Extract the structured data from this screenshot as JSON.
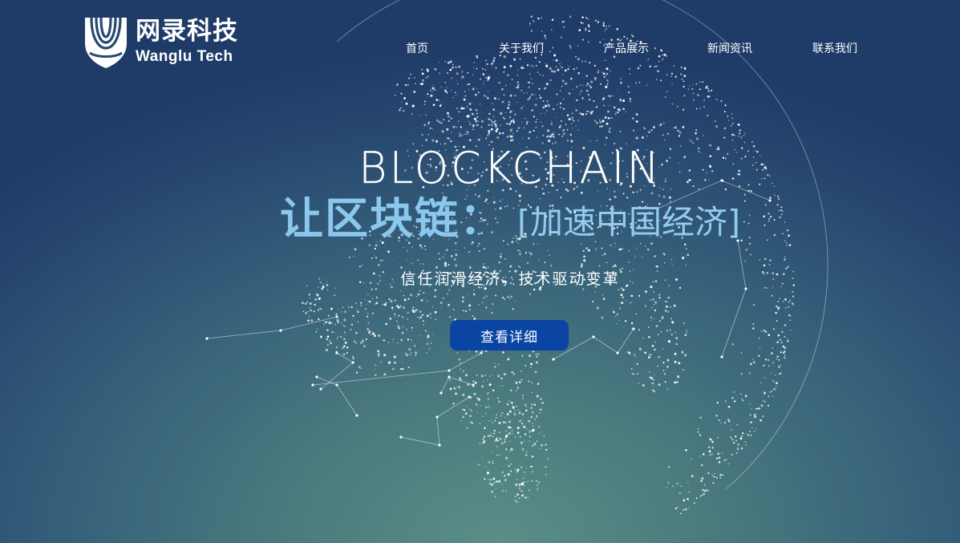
{
  "brand": {
    "name_cn": "网录科技",
    "name_en": "Wanglu Tech",
    "logo_icon": "shield-swirl-logo"
  },
  "nav": {
    "items": [
      {
        "label": "首页"
      },
      {
        "label": "关于我们"
      },
      {
        "label": "产品展示"
      },
      {
        "label": "新闻资讯"
      },
      {
        "label": "联系我们"
      }
    ]
  },
  "hero": {
    "heading_en": "BLOCKCHAIN",
    "title_bold": "让区块链：",
    "title_light": "[加速中国经济]",
    "subtitle": "信任润滑经济，技术驱动变革",
    "cta_label": "查看详细",
    "background_icon": "digital-globe"
  },
  "colors": {
    "bg_top": "#1f3b68",
    "bg_bottom": "#5a8e86",
    "title_blue": "#8cc8ee",
    "cta_blue": "#0a45a3"
  }
}
